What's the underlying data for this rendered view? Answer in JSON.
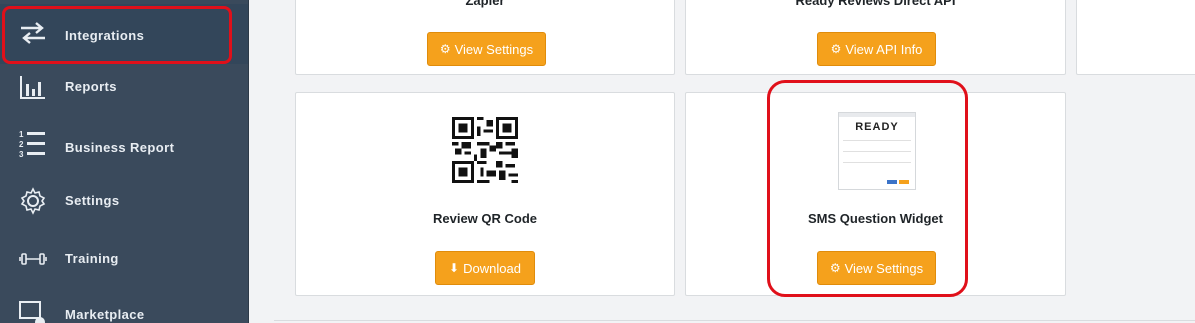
{
  "sidebar": {
    "items": [
      {
        "label": "Integrations",
        "icon": "arrows-swap-icon",
        "active": true
      },
      {
        "label": "Reports",
        "icon": "bar-chart-icon"
      },
      {
        "label": "Business Report",
        "icon": "numbered-list-icon"
      },
      {
        "label": "Settings",
        "icon": "gear-icon"
      },
      {
        "label": "Training",
        "icon": "dumbbell-icon"
      },
      {
        "label": "Marketplace",
        "icon": "marketplace-icon"
      }
    ]
  },
  "cards": {
    "zapier": {
      "title": "Zapier",
      "button": "View Settings",
      "button_icon": "gear-icon"
    },
    "ready_reviews_api": {
      "title": "Ready Reviews Direct API",
      "button": "View API Info",
      "button_icon": "gear-icon"
    },
    "qr_code": {
      "title": "Review QR Code",
      "button": "Download",
      "button_icon": "download-icon",
      "image": "qr-code-image"
    },
    "sms_widget": {
      "title": "SMS Question Widget",
      "button": "View Settings",
      "button_icon": "gear-icon",
      "image": "widget-preview-image",
      "preview_logo": "READY"
    }
  },
  "colors": {
    "sidebar_bg": "#3a4a5c",
    "button": "#f5a11c",
    "highlight": "#e0101a"
  }
}
